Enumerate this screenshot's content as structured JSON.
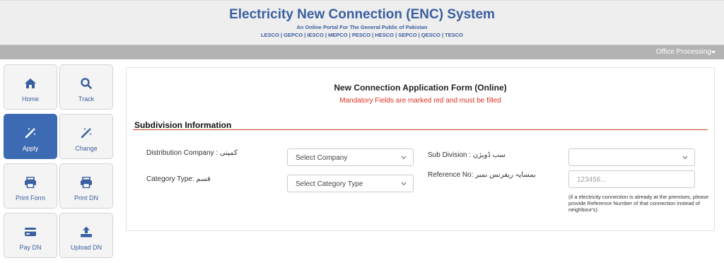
{
  "header": {
    "title": "Electricity New Connection (ENC) System",
    "subtitle": "An Online Portal For The General Public of Pakistan",
    "companies": "LESCO | GEPCO | IESCO | MEPCO | PESCO | HESCO | SEPCO | QESCO | TESCO"
  },
  "navbar": {
    "office_label": "Office Processing"
  },
  "sidebar": {
    "tiles": [
      {
        "label": "Home",
        "icon": "home-icon"
      },
      {
        "label": "Track",
        "icon": "search-icon"
      },
      {
        "label": "Apply",
        "icon": "magic-wand-icon",
        "active": true
      },
      {
        "label": "Change",
        "icon": "magic-wand-icon"
      },
      {
        "label": "Print Form",
        "icon": "printer-icon"
      },
      {
        "label": "Print DN",
        "icon": "printer-icon"
      },
      {
        "label": "Pay DN",
        "icon": "credit-card-icon"
      },
      {
        "label": "Upload DN",
        "icon": "upload-icon"
      }
    ]
  },
  "form": {
    "title": "New Connection Application Form (Online)",
    "mandatory_note": "Mandatory Fields are marked red and must be filled",
    "section_title": "Subdivision Information",
    "distribution_company": {
      "label": "Distribution Company : کمپنی",
      "value": "Select Company"
    },
    "category_type": {
      "label": "Category Type:  قسم",
      "value": "Select Category Type"
    },
    "sub_division": {
      "label": "Sub Division : سب ڈویژن",
      "value": ""
    },
    "reference_no": {
      "label": "Reference No: بمسایہ ریفرنس نمبر",
      "placeholder": "123456..."
    },
    "reference_help": "(if a electricity connection is already at the premises, please provide Reference Number of that connection instead of neighbour's)"
  },
  "colors": {
    "brand_blue": "#3a5fa0",
    "active_tile": "#3d6bb3",
    "mandatory_red": "#e0301e",
    "section_rule": "#c0471f"
  }
}
